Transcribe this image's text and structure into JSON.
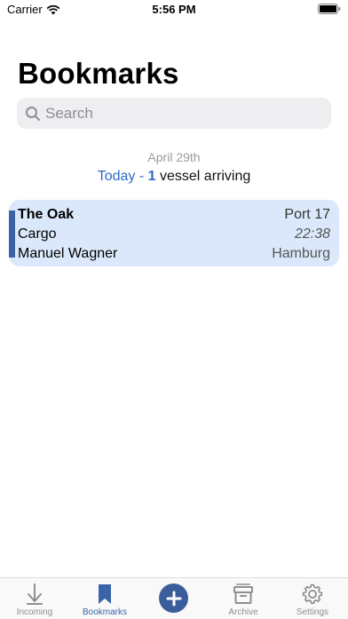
{
  "status_bar": {
    "carrier": "Carrier",
    "time": "5:56 PM"
  },
  "header": {
    "title": "Bookmarks"
  },
  "search": {
    "placeholder": "Search"
  },
  "section": {
    "date": "April 29th",
    "today_label": "Today -",
    "count": "1",
    "suffix": "vessel arriving"
  },
  "vessels": [
    {
      "name": "The Oak",
      "type": "Cargo",
      "agent": "Manuel Wagner",
      "port": "Port 17",
      "time": "22:38",
      "city": "Hamburg"
    }
  ],
  "tabs": [
    {
      "label": "Incoming",
      "icon": "arrow-down-icon",
      "active": false
    },
    {
      "label": "Bookmarks",
      "icon": "bookmark-icon",
      "active": true
    },
    {
      "label": "",
      "icon": "plus-icon",
      "active": false
    },
    {
      "label": "Archive",
      "icon": "archive-box-icon",
      "active": false
    },
    {
      "label": "Settings",
      "icon": "gear-icon",
      "active": false
    }
  ],
  "colors": {
    "accent": "#3a64a8",
    "card_background": "#dbe8fb",
    "link_blue": "#2f6bc3"
  }
}
